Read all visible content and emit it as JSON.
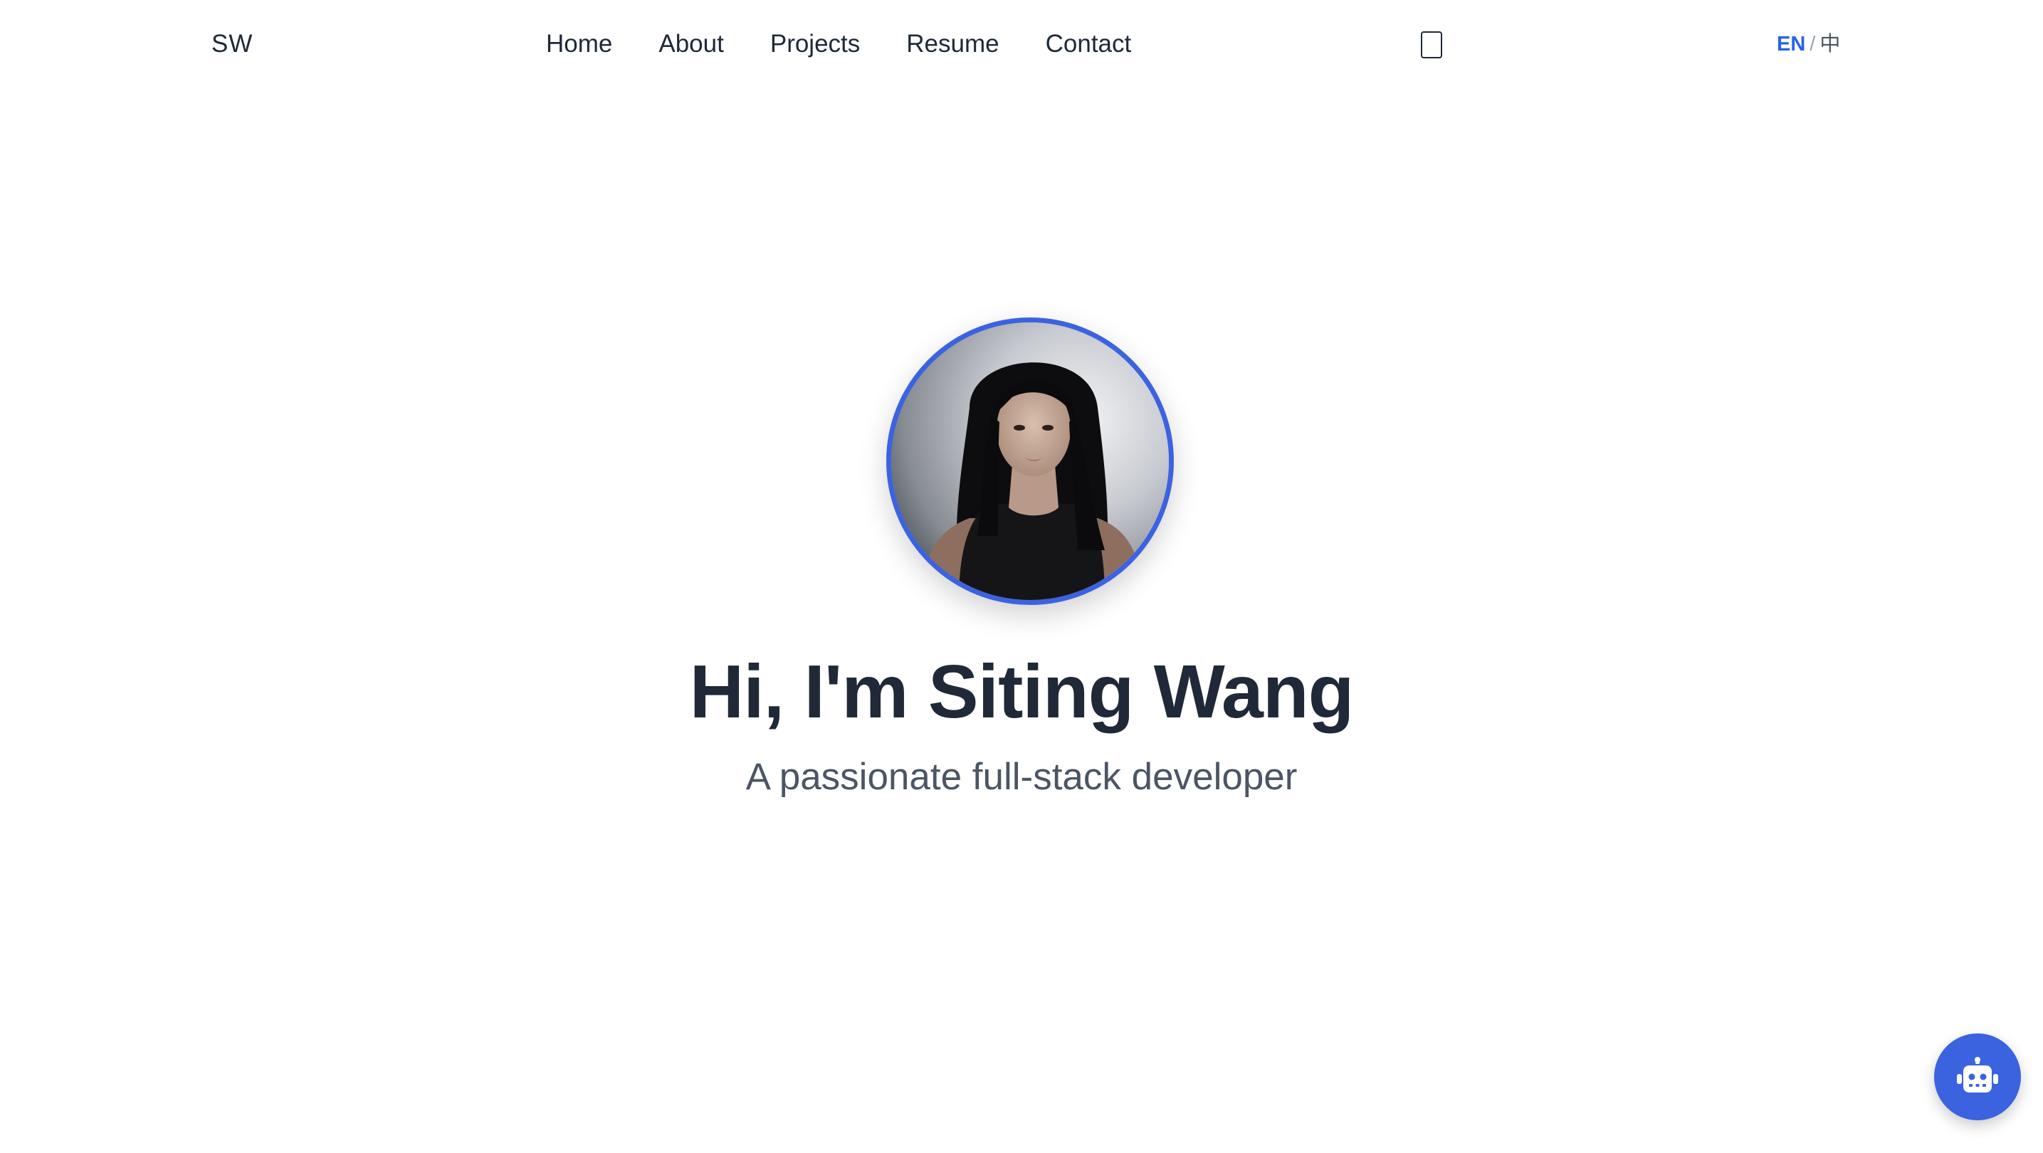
{
  "header": {
    "logo": "SW",
    "nav": [
      {
        "label": "Home"
      },
      {
        "label": "About"
      },
      {
        "label": "Projects"
      },
      {
        "label": "Resume"
      },
      {
        "label": "Contact"
      }
    ],
    "theme_toggle_icon": "moon-icon",
    "language": {
      "en": "EN",
      "separator": "/",
      "zh": "中"
    }
  },
  "hero": {
    "title": "Hi, I'm Siting Wang",
    "subtitle": "A passionate full-stack developer",
    "avatar_icon": "profile-photo"
  },
  "chat": {
    "icon": "robot-icon"
  },
  "colors": {
    "accent": "#3b63e0",
    "text_primary": "#1f2937",
    "text_secondary": "#4b5563",
    "lang_active": "#2563eb"
  }
}
